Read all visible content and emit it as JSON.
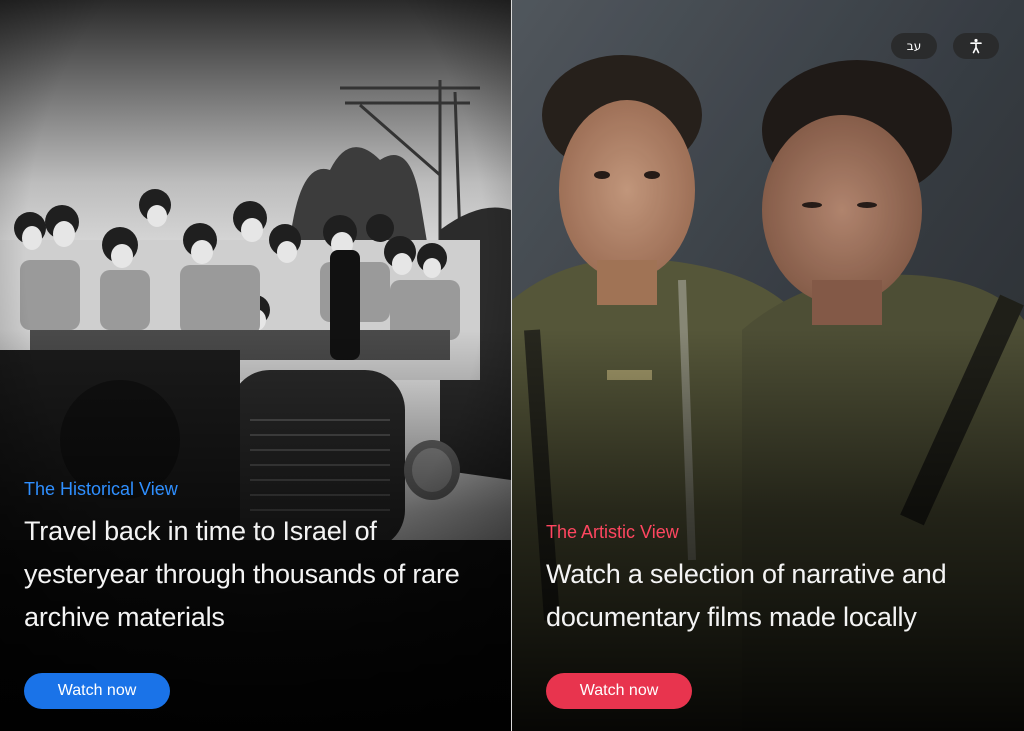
{
  "top_controls": {
    "language_label": "עב",
    "accessibility_icon": "accessibility-icon"
  },
  "panels": [
    {
      "kicker": "The Historical View",
      "headline": "Travel back in time to Israel of yesteryear through thousands of rare archive materials",
      "button_label": "Watch now",
      "accent": "#1a73e8"
    },
    {
      "kicker": "The Artistic View",
      "headline": "Watch a selection of narrative and documentary films made locally",
      "button_label": "Watch now",
      "accent": "#e8344e"
    }
  ]
}
